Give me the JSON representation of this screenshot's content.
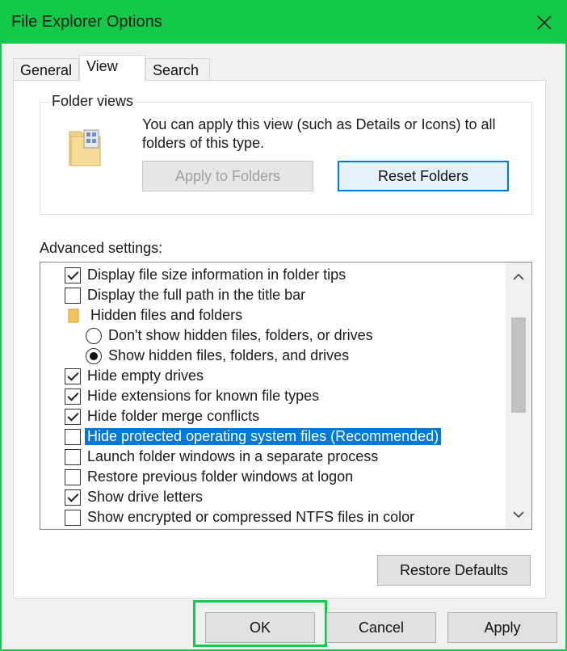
{
  "window": {
    "title": "File Explorer Options"
  },
  "tabs": [
    {
      "label": "General"
    },
    {
      "label": "View"
    },
    {
      "label": "Search"
    }
  ],
  "folder_views": {
    "title": "Folder views",
    "description": "You can apply this view (such as Details or Icons) to all folders of this type.",
    "apply_button": "Apply to Folders",
    "reset_button": "Reset Folders"
  },
  "advanced": {
    "label": "Advanced settings:",
    "items": [
      {
        "type": "checkbox",
        "checked": true,
        "label": "Display file size information in folder tips"
      },
      {
        "type": "checkbox",
        "checked": false,
        "label": "Display the full path in the title bar"
      },
      {
        "type": "folder",
        "label": "Hidden files and folders"
      },
      {
        "type": "radio",
        "checked": false,
        "label": "Don't show hidden files, folders, or drives"
      },
      {
        "type": "radio",
        "checked": true,
        "label": "Show hidden files, folders, and drives"
      },
      {
        "type": "checkbox",
        "checked": true,
        "label": "Hide empty drives"
      },
      {
        "type": "checkbox",
        "checked": true,
        "label": "Hide extensions for known file types"
      },
      {
        "type": "checkbox",
        "checked": true,
        "label": "Hide folder merge conflicts"
      },
      {
        "type": "checkbox",
        "checked": false,
        "label": "Hide protected operating system files (Recommended)",
        "selected": true
      },
      {
        "type": "checkbox",
        "checked": false,
        "label": "Launch folder windows in a separate process"
      },
      {
        "type": "checkbox",
        "checked": false,
        "label": "Restore previous folder windows at logon"
      },
      {
        "type": "checkbox",
        "checked": true,
        "label": "Show drive letters"
      },
      {
        "type": "checkbox",
        "checked": false,
        "label": "Show encrypted or compressed NTFS files in color"
      }
    ],
    "restore_defaults": "Restore Defaults"
  },
  "dialog_buttons": {
    "ok": "OK",
    "cancel": "Cancel",
    "apply": "Apply"
  },
  "colors": {
    "highlight_green": "#12c94a",
    "selection_blue": "#0078d7"
  }
}
